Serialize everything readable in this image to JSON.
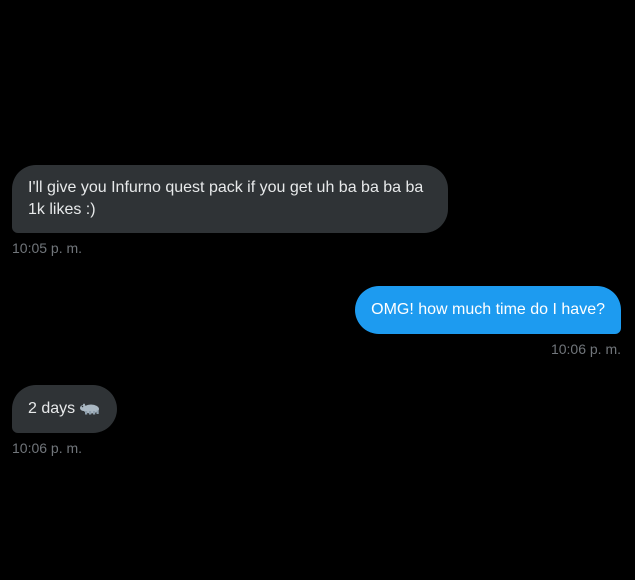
{
  "messages": [
    {
      "direction": "incoming",
      "text": "I'll give you Infurno quest pack if you get uh ba ba ba ba 1k likes :)",
      "time": "10:05 p. m."
    },
    {
      "direction": "outgoing",
      "text": "OMG! how much time do I have?",
      "time": "10:06 p. m."
    },
    {
      "direction": "incoming",
      "text": "2 days",
      "emoji": "hippo-emoji",
      "time": "10:06 p. m."
    }
  ],
  "colors": {
    "background": "#000000",
    "incoming_bubble": "#2f3336",
    "outgoing_bubble": "#1d9bf0",
    "timestamp": "#71767b"
  }
}
